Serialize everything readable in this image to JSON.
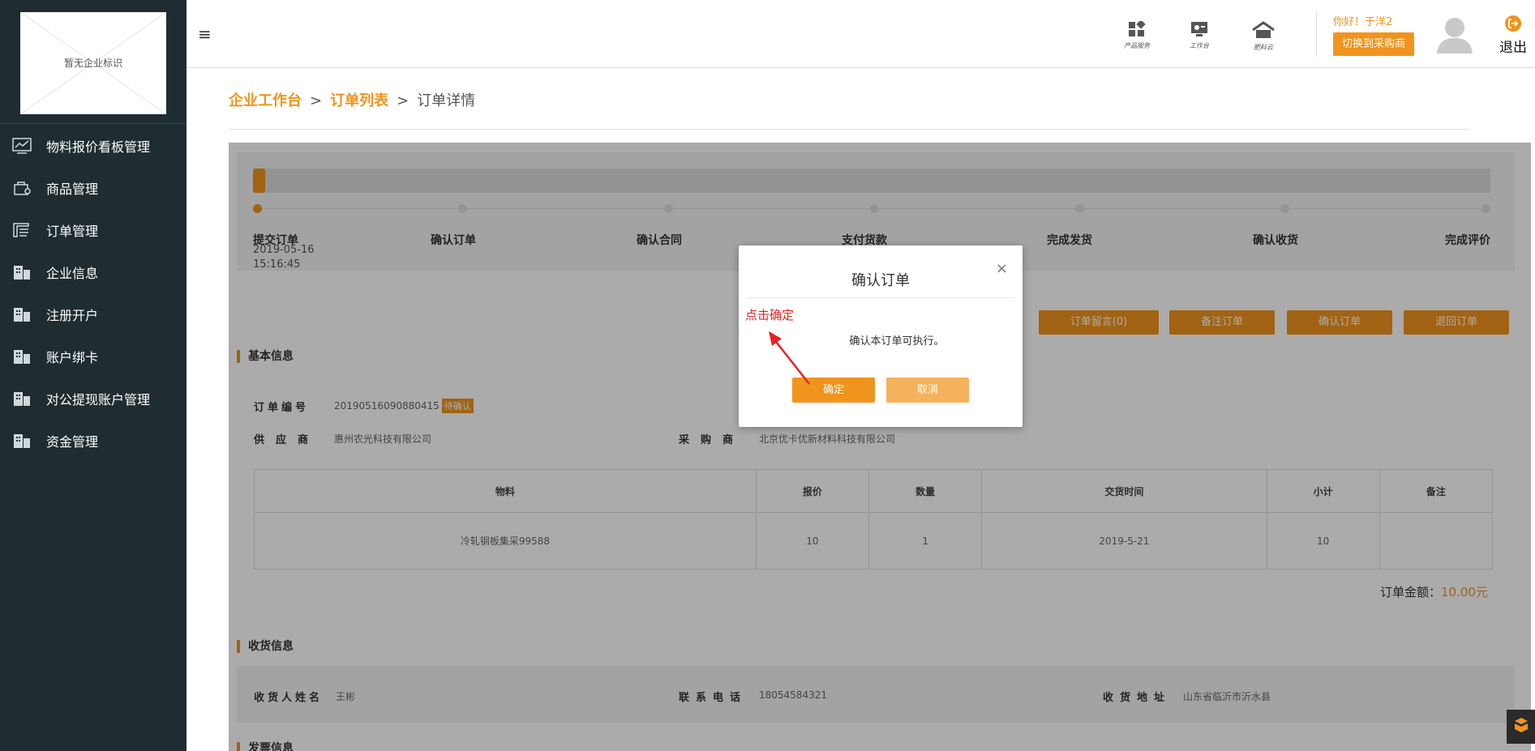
{
  "sidebar": {
    "logo_text": "暂无企业标识",
    "items": [
      {
        "label": "物料报价看板管理",
        "icon": "chart-line-icon"
      },
      {
        "label": "商品管理",
        "icon": "goods-icon"
      },
      {
        "label": "订单管理",
        "icon": "order-icon"
      },
      {
        "label": "企业信息",
        "icon": "building-icon"
      },
      {
        "label": "注册开户",
        "icon": "building-icon"
      },
      {
        "label": "账户绑卡",
        "icon": "building-icon"
      },
      {
        "label": "对公提现账户管理",
        "icon": "building-icon"
      },
      {
        "label": "资金管理",
        "icon": "building-icon"
      }
    ]
  },
  "header": {
    "menu_glyph": "≡",
    "icons": [
      {
        "caption": "产品服务",
        "icon": "product-service-icon"
      },
      {
        "caption": "工作台",
        "icon": "workbench-icon"
      },
      {
        "caption": "肥料云",
        "icon": "home-icon"
      }
    ],
    "greeting": "你好！于洋2",
    "switch_label": "切换到采购商",
    "logout_label": "退出"
  },
  "breadcrumb": {
    "items": [
      "企业工作台",
      "订单列表"
    ],
    "current": "订单详情",
    "separator": ">"
  },
  "progress": {
    "fraction": 0.01,
    "steps": [
      "提交订单",
      "确认订单",
      "确认合同",
      "支付货款",
      "完成发货",
      "确认收货",
      "完成评价"
    ],
    "first_date": "2019-05-16",
    "first_time": "15:16:45"
  },
  "actions": [
    "订单留言(0)",
    "备注订单",
    "确认订单",
    "退回订单"
  ],
  "basic_info": {
    "section_title": "基本信息",
    "order_no_label": "订单编号",
    "order_no": "20190516090880415",
    "status_badge": "待确认",
    "supplier_label": "供应商",
    "supplier": "惠州农光科技有限公司",
    "buyer_label": "采购商",
    "buyer": "北京优卡优新材料科技有限公司"
  },
  "table": {
    "headers": [
      "物料",
      "报价",
      "数量",
      "交货时间",
      "小计",
      "备注"
    ],
    "rows": [
      [
        "冷轧钢板集采99588",
        "10",
        "1",
        "2019-5-21",
        "10",
        ""
      ]
    ]
  },
  "total": {
    "label": "订单金额：",
    "amount": "10.00元"
  },
  "receiving": {
    "section_title": "收货信息",
    "name_label": "收货人姓名",
    "name": "王彬",
    "phone_label": "联系电话",
    "phone": "18054584321",
    "address_label": "收货地址",
    "address": "山东省临沂市沂水县"
  },
  "invoice_section_title": "发票信息",
  "modal": {
    "title": "确认订单",
    "close_glyph": "×",
    "annotation": "点击确定",
    "message": "确认本订单可执行。",
    "ok_label": "确定",
    "cancel_label": "取消"
  },
  "colors": {
    "accent": "#f0941d",
    "sidebar": "#1f2d32",
    "annotation": "#e62222"
  }
}
